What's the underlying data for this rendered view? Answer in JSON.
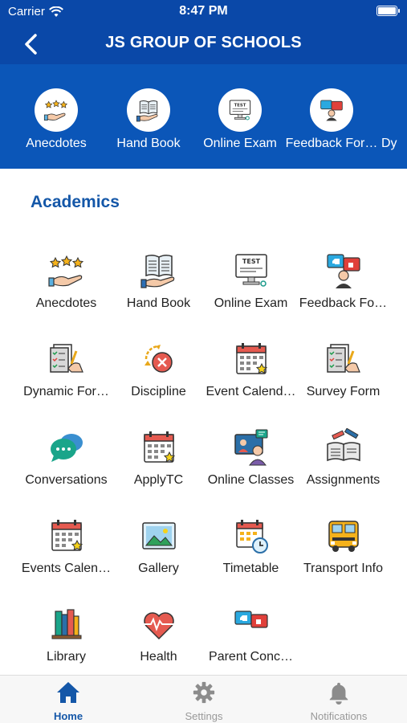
{
  "status_bar": {
    "carrier": "Carrier",
    "time": "8:47 PM"
  },
  "nav": {
    "title": "JS GROUP OF SCHOOLS"
  },
  "quick_strip": [
    {
      "label": "Anecdotes",
      "icon": "anecdotes-icon"
    },
    {
      "label": "Hand Book",
      "icon": "handbook-icon"
    },
    {
      "label": "Online Exam",
      "icon": "online-exam-icon"
    },
    {
      "label": "Feedback For…",
      "icon": "feedback-icon"
    },
    {
      "label": "Dy",
      "icon": "dynamic-form-icon"
    }
  ],
  "section": {
    "title": "Academics"
  },
  "grid": [
    {
      "label": "Anecdotes",
      "icon": "anecdotes-icon"
    },
    {
      "label": "Hand Book",
      "icon": "handbook-icon"
    },
    {
      "label": "Online Exam",
      "icon": "online-exam-icon"
    },
    {
      "label": "Feedback Fo…",
      "icon": "feedback-icon"
    },
    {
      "label": "Dynamic For…",
      "icon": "dynamic-form-icon"
    },
    {
      "label": "Discipline",
      "icon": "discipline-icon"
    },
    {
      "label": "Event Calend…",
      "icon": "event-calendar-icon"
    },
    {
      "label": "Survey Form",
      "icon": "survey-form-icon"
    },
    {
      "label": "Conversations",
      "icon": "conversations-icon"
    },
    {
      "label": "ApplyTC",
      "icon": "apply-tc-icon"
    },
    {
      "label": "Online Classes",
      "icon": "online-classes-icon"
    },
    {
      "label": "Assignments",
      "icon": "assignments-icon"
    },
    {
      "label": "Events Calen…",
      "icon": "events-calendar-icon"
    },
    {
      "label": "Gallery",
      "icon": "gallery-icon"
    },
    {
      "label": "Timetable",
      "icon": "timetable-icon"
    },
    {
      "label": "Transport Info",
      "icon": "transport-icon"
    },
    {
      "label": "Library",
      "icon": "library-icon"
    },
    {
      "label": "Health",
      "icon": "health-icon"
    },
    {
      "label": "Parent Conc…",
      "icon": "parent-concern-icon"
    }
  ],
  "tabs": [
    {
      "label": "Home",
      "icon": "home-icon",
      "active": true
    },
    {
      "label": "Settings",
      "icon": "gear-icon",
      "active": false
    },
    {
      "label": "Notifications",
      "icon": "bell-icon",
      "active": false
    }
  ],
  "colors": {
    "primary": "#0a48a8",
    "strip": "#0b56b8",
    "accent": "#1457a8"
  }
}
